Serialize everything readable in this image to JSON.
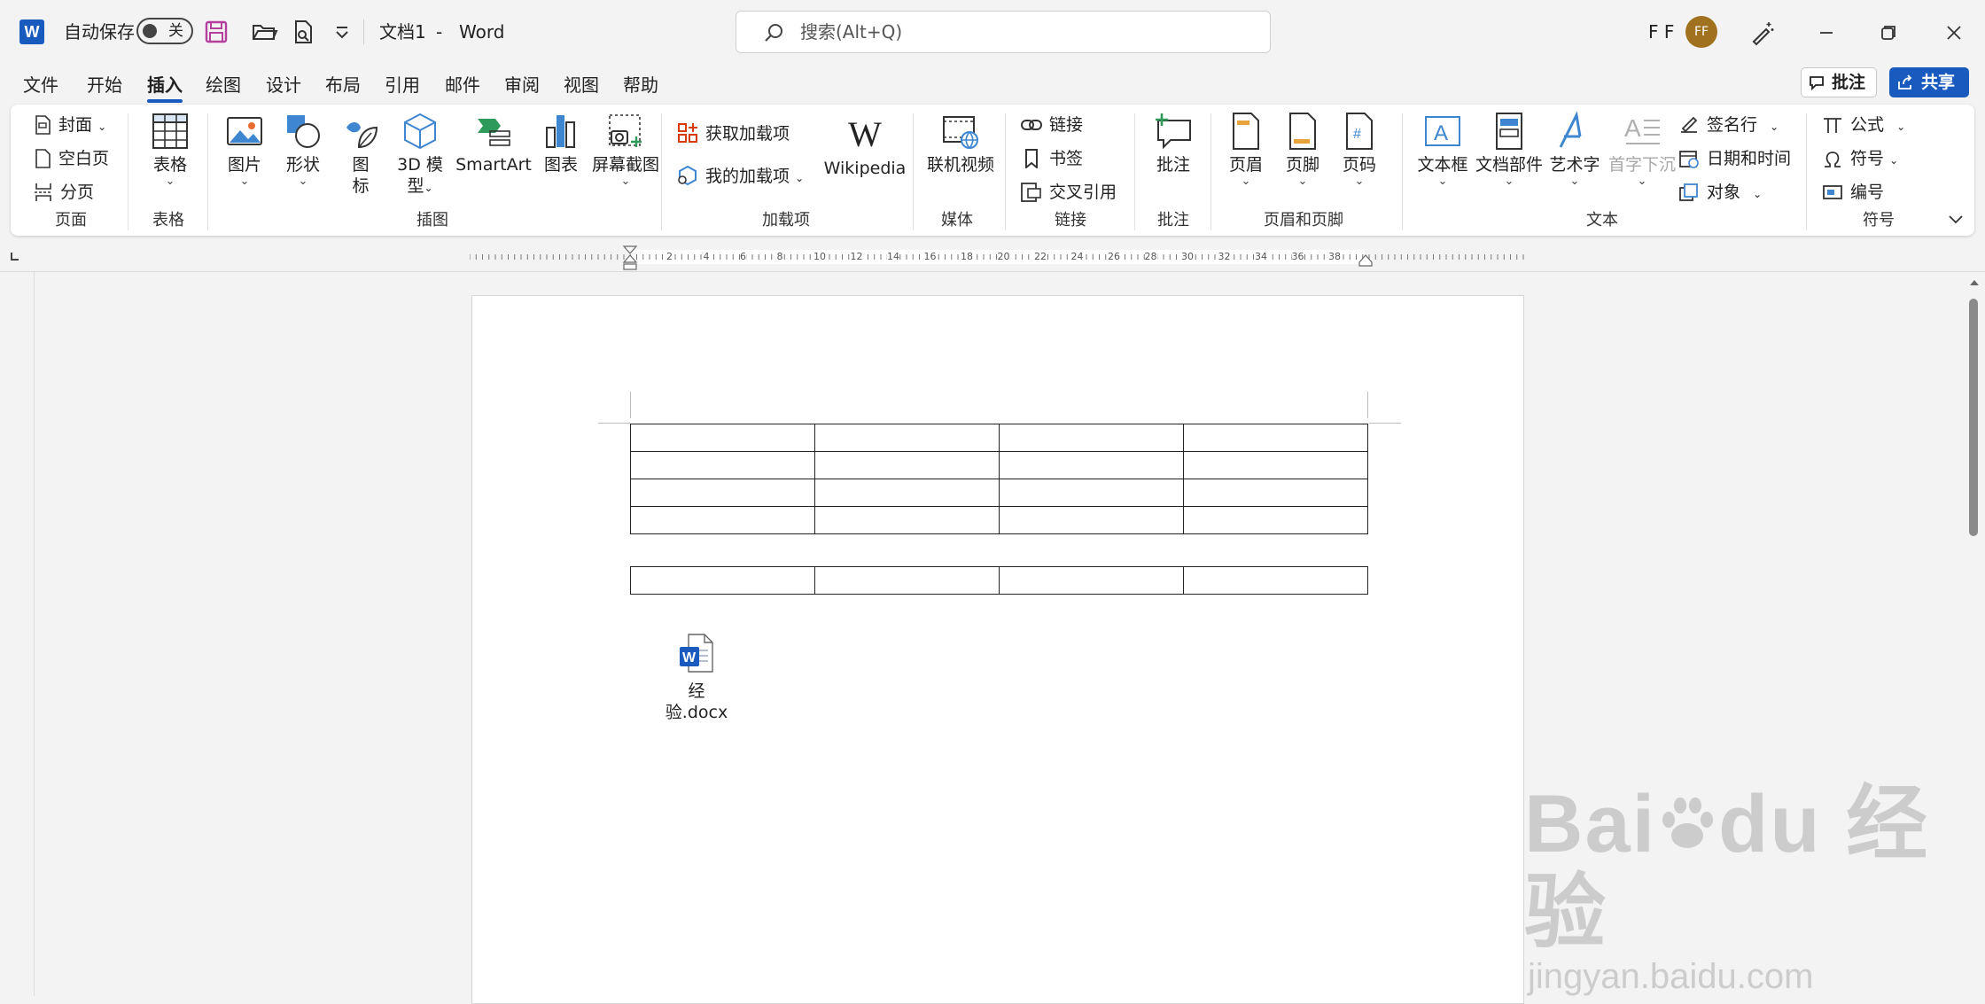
{
  "titlebar": {
    "autosave_label": "自动保存",
    "autosave_state": "关",
    "doc_title": "文档1",
    "separator": "-",
    "app_name": "Word",
    "search_placeholder": "搜索(Alt+Q)",
    "user_name": "F F",
    "avatar_initials": "FF"
  },
  "tabs": [
    "文件",
    "开始",
    "插入",
    "绘图",
    "设计",
    "布局",
    "引用",
    "邮件",
    "审阅",
    "视图",
    "帮助"
  ],
  "active_tab": "插入",
  "actions": {
    "comment": "批注",
    "share": "共享"
  },
  "ribbon": {
    "pages": {
      "cover": "封面",
      "blank": "空白页",
      "break": "分页",
      "group": "页面"
    },
    "tables": {
      "table": "表格",
      "group": "表格"
    },
    "illustrations": {
      "picture": "图片",
      "shapes": "形状",
      "icons_1": "图",
      "icons_2": "标",
      "model_1": "3D 模",
      "model_2": "型",
      "smartart": "SmartArt",
      "chart": "图表",
      "screenshot": "屏幕截图",
      "group": "插图"
    },
    "addins": {
      "get": "获取加载项",
      "mine": "我的加载项",
      "wiki": "Wikipedia",
      "group": "加载项"
    },
    "media": {
      "video": "联机视频",
      "group": "媒体"
    },
    "links": {
      "link": "链接",
      "bookmark": "书签",
      "crossref": "交叉引用",
      "group": "链接"
    },
    "comments": {
      "comment": "批注",
      "group": "批注"
    },
    "headerfooter": {
      "header": "页眉",
      "footer": "页脚",
      "pagenum": "页码",
      "group": "页眉和页脚"
    },
    "text": {
      "textbox": "文本框",
      "parts": "文档部件",
      "wordart": "艺术字",
      "dropcap": "首字下沉",
      "signature": "签名行",
      "datetime": "日期和时间",
      "object": "对象",
      "group": "文本"
    },
    "symbols": {
      "equation": "公式",
      "symbol": "符号",
      "number": "编号",
      "group": "符号"
    }
  },
  "ruler": {
    "numbers": [
      "2",
      "4",
      "6",
      "8",
      "10",
      "12",
      "14",
      "16",
      "18",
      "20",
      "22",
      "24",
      "26",
      "28",
      "30",
      "32",
      "34",
      "36",
      "38"
    ]
  },
  "document": {
    "table1_rows": 4,
    "table2_rows": 1,
    "columns": 4,
    "attachment_name": "经验.docx",
    "attachment_icon_letter": "W"
  },
  "watermark": {
    "brand": "Bai",
    "brand2": "du",
    "cn": "经验",
    "url": "jingyan.baidu.com"
  },
  "colors": {
    "accent": "#185abd",
    "avatar": "#a0711f"
  }
}
